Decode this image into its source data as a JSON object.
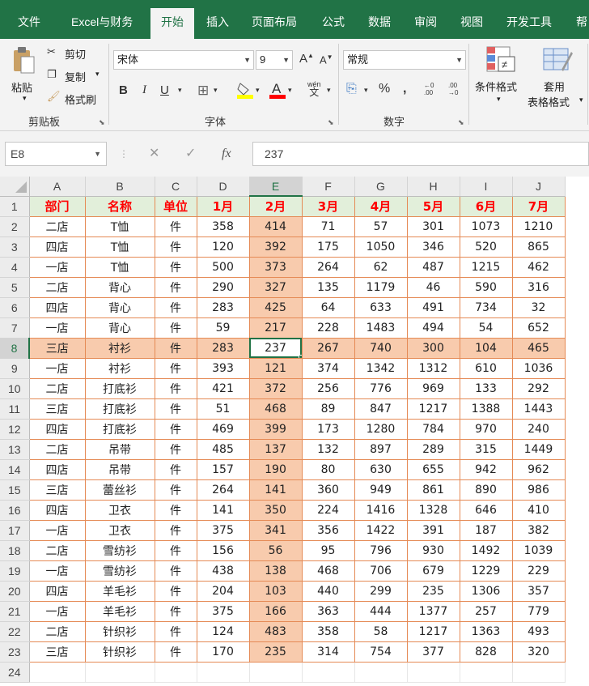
{
  "menu": {
    "tabs": [
      "文件",
      "Excel与财务",
      "开始",
      "插入",
      "页面布局",
      "公式",
      "数据",
      "审阅",
      "视图",
      "开发工具",
      "帮"
    ]
  },
  "ribbon": {
    "clipboard": {
      "paste": "粘贴",
      "cut": "剪切",
      "copy": "复制",
      "format_painter": "格式刷",
      "group": "剪贴板"
    },
    "font": {
      "name": "宋体",
      "size": "9",
      "bold": "B",
      "italic": "I",
      "underline": "U",
      "wen": "wén",
      "wen2": "文",
      "group": "字体"
    },
    "number": {
      "format": "常规",
      "percent": "%",
      "comma": ",",
      "inc": "←0 .00",
      "dec": ".00 →0",
      "group": "数字"
    },
    "styles": {
      "conditional": "条件格式",
      "table1": "套用",
      "table2": "表格格式"
    }
  },
  "formula_bar": {
    "name_box": "E8",
    "fx": "fx",
    "value": "237"
  },
  "grid": {
    "columns": [
      "A",
      "B",
      "C",
      "D",
      "E",
      "F",
      "G",
      "H",
      "I",
      "J"
    ],
    "selected_column": "E",
    "selected_row": 8,
    "active_cell": "E8",
    "header": [
      "部门",
      "名称",
      "单位",
      "1月",
      "2月",
      "3月",
      "4月",
      "5月",
      "6月",
      "7月"
    ],
    "rows": [
      [
        "二店",
        "T恤",
        "件",
        "358",
        "414",
        "71",
        "57",
        "301",
        "1073",
        "1210"
      ],
      [
        "四店",
        "T恤",
        "件",
        "120",
        "392",
        "175",
        "1050",
        "346",
        "520",
        "865"
      ],
      [
        "一店",
        "T恤",
        "件",
        "500",
        "373",
        "264",
        "62",
        "487",
        "1215",
        "462"
      ],
      [
        "二店",
        "背心",
        "件",
        "290",
        "327",
        "135",
        "1179",
        "46",
        "590",
        "316"
      ],
      [
        "四店",
        "背心",
        "件",
        "283",
        "425",
        "64",
        "633",
        "491",
        "734",
        "32"
      ],
      [
        "一店",
        "背心",
        "件",
        "59",
        "217",
        "228",
        "1483",
        "494",
        "54",
        "652"
      ],
      [
        "三店",
        "衬衫",
        "件",
        "283",
        "237",
        "267",
        "740",
        "300",
        "104",
        "465"
      ],
      [
        "一店",
        "衬衫",
        "件",
        "393",
        "121",
        "374",
        "1342",
        "1312",
        "610",
        "1036"
      ],
      [
        "二店",
        "打底衫",
        "件",
        "421",
        "372",
        "256",
        "776",
        "969",
        "133",
        "292"
      ],
      [
        "三店",
        "打底衫",
        "件",
        "51",
        "468",
        "89",
        "847",
        "1217",
        "1388",
        "1443"
      ],
      [
        "四店",
        "打底衫",
        "件",
        "469",
        "399",
        "173",
        "1280",
        "784",
        "970",
        "240"
      ],
      [
        "二店",
        "吊带",
        "件",
        "485",
        "137",
        "132",
        "897",
        "289",
        "315",
        "1449"
      ],
      [
        "四店",
        "吊带",
        "件",
        "157",
        "190",
        "80",
        "630",
        "655",
        "942",
        "962"
      ],
      [
        "三店",
        "蕾丝衫",
        "件",
        "264",
        "141",
        "360",
        "949",
        "861",
        "890",
        "986"
      ],
      [
        "四店",
        "卫衣",
        "件",
        "141",
        "350",
        "224",
        "1416",
        "1328",
        "646",
        "410"
      ],
      [
        "一店",
        "卫衣",
        "件",
        "375",
        "341",
        "356",
        "1422",
        "391",
        "187",
        "382"
      ],
      [
        "二店",
        "雪纺衫",
        "件",
        "156",
        "56",
        "95",
        "796",
        "930",
        "1492",
        "1039"
      ],
      [
        "一店",
        "雪纺衫",
        "件",
        "438",
        "138",
        "468",
        "706",
        "679",
        "1229",
        "229"
      ],
      [
        "四店",
        "羊毛衫",
        "件",
        "204",
        "103",
        "440",
        "299",
        "235",
        "1306",
        "357"
      ],
      [
        "一店",
        "羊毛衫",
        "件",
        "375",
        "166",
        "363",
        "444",
        "1377",
        "257",
        "779"
      ],
      [
        "二店",
        "针织衫",
        "件",
        "124",
        "483",
        "358",
        "58",
        "1217",
        "1363",
        "493"
      ],
      [
        "三店",
        "针织衫",
        "件",
        "170",
        "235",
        "314",
        "754",
        "377",
        "828",
        "320"
      ]
    ],
    "empty_row_number": "24"
  },
  "colors": {
    "accent": "#217346",
    "header_fill": "#e2efda",
    "header_text": "#ff0000",
    "highlight": "#f8cbad",
    "border": "#e58a55"
  }
}
